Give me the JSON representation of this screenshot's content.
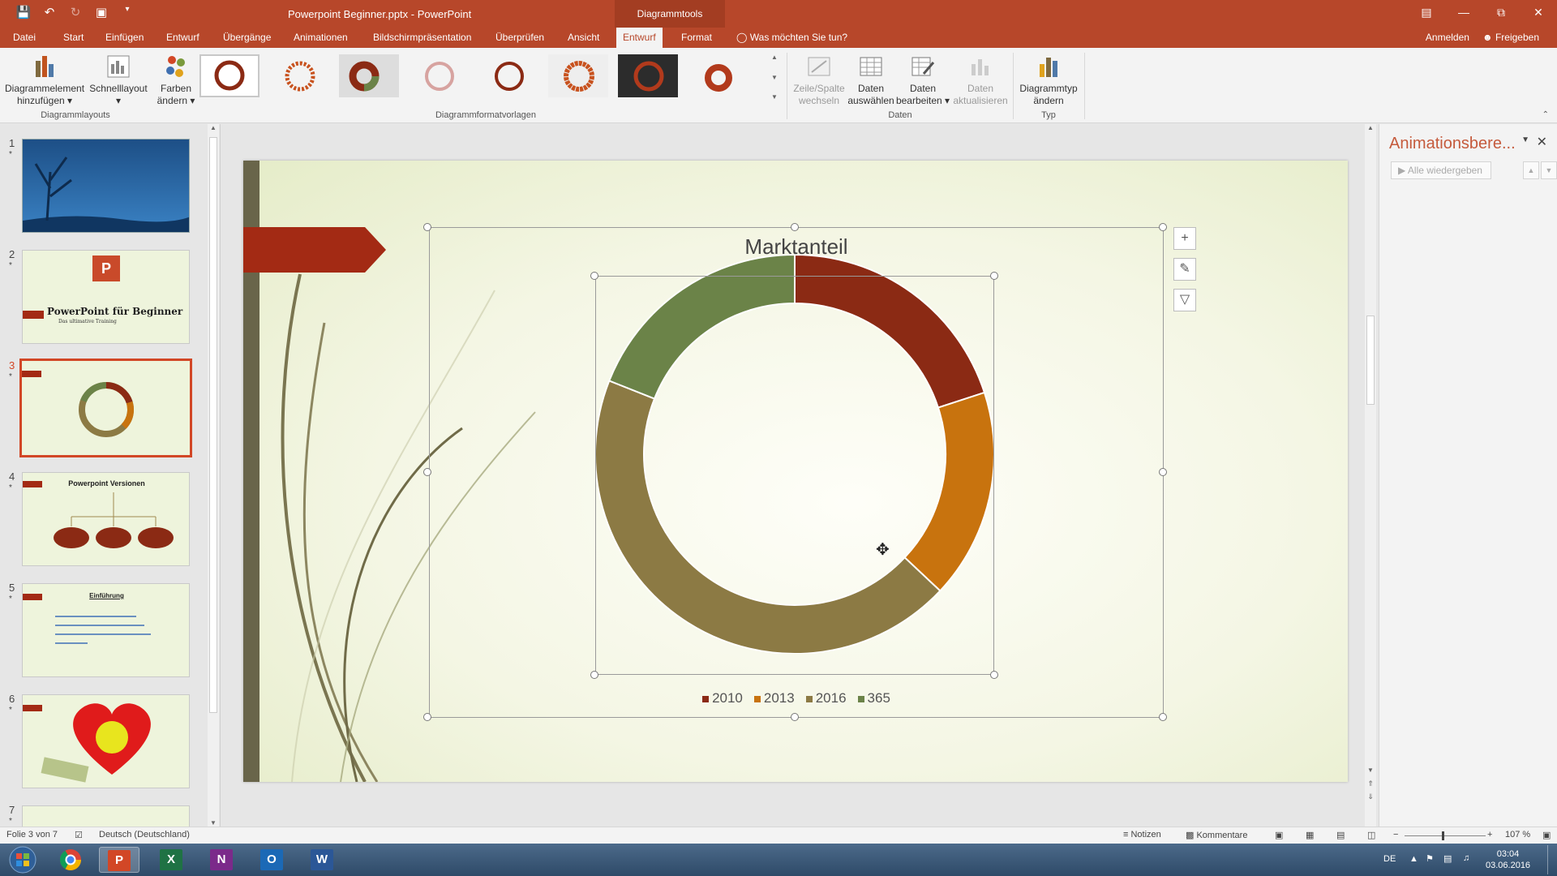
{
  "app": {
    "document_title": "Powerpoint Beginner.pptx - PowerPoint",
    "contextual_tab_group": "Diagrammtools"
  },
  "menu": {
    "tabs": [
      "Datei",
      "Start",
      "Einfügen",
      "Entwurf",
      "Übergänge",
      "Animationen",
      "Bildschirmpräsentation",
      "Überprüfen",
      "Ansicht",
      "Entwurf",
      "Format"
    ],
    "active_index": 9,
    "tell_me": "Was möchten Sie tun?",
    "sign_in": "Anmelden",
    "share": "Freigeben"
  },
  "ribbon": {
    "add_element_l1": "Diagrammelement",
    "add_element_l2": "hinzufügen",
    "quick_layout": "Schnelllayout",
    "colors_l1": "Farben",
    "colors_l2": "ändern",
    "group_layouts": "Diagrammlayouts",
    "group_styles": "Diagrammformatvorlagen",
    "switch_l1": "Zeile/Spalte",
    "switch_l2": "wechseln",
    "select_l1": "Daten",
    "select_l2": "auswählen",
    "edit_l1": "Daten",
    "edit_l2": "bearbeiten",
    "refresh_l1": "Daten",
    "refresh_l2": "aktualisieren",
    "group_data": "Daten",
    "change_type_l1": "Diagrammtyp",
    "change_type_l2": "ändern",
    "group_type": "Typ"
  },
  "slides": [
    {
      "number": "1"
    },
    {
      "number": "2",
      "title": "PowerPoint für Beginner",
      "subtitle": "Das ultimative Training"
    },
    {
      "number": "3"
    },
    {
      "number": "4",
      "title": "Powerpoint Versionen"
    },
    {
      "number": "5",
      "title": "Einführung"
    },
    {
      "number": "6"
    },
    {
      "number": "7"
    }
  ],
  "slide_star": "*",
  "chart_data": {
    "type": "pie",
    "variant": "doughnut",
    "title": "Marktanteil",
    "categories": [
      "2010",
      "2013",
      "2016",
      "365"
    ],
    "values": [
      20,
      17,
      44,
      19
    ],
    "colors": [
      "#8b2a14",
      "#c8730e",
      "#8c7a44",
      "#6b8348"
    ],
    "legend_position": "bottom"
  },
  "chart_tools": {
    "elements_icon": "plus-icon",
    "styles_icon": "brush-icon",
    "filter_icon": "filter-icon"
  },
  "animation_pane": {
    "title": "Animationsbere...",
    "play_all": "Alle wiedergeben"
  },
  "status": {
    "slide_info": "Folie 3 von 7",
    "language": "Deutsch (Deutschland)",
    "notes": "Notizen",
    "comments": "Kommentare",
    "zoom": "107 %"
  },
  "taskbar": {
    "apps": [
      "Chrome",
      "PowerPoint",
      "Excel",
      "OneNote",
      "Outlook",
      "Word"
    ],
    "lang": "DE",
    "time": "03:04",
    "date": "03.06.2016"
  },
  "colors": {
    "accent": "#b7472a",
    "selection": "#d24726"
  }
}
